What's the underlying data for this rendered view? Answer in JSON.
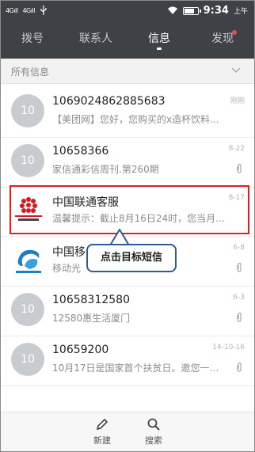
{
  "status_bar": {
    "signal_1": "4G",
    "signal_2": "4G",
    "time": "9:34",
    "ampm": "上午",
    "battery_level": 0.85
  },
  "tabs": [
    {
      "label": "拨号",
      "active": false
    },
    {
      "label": "联系人",
      "active": false
    },
    {
      "label": "信息",
      "active": true
    },
    {
      "label": "发现",
      "active": false,
      "badge": true
    }
  ],
  "section": {
    "label": "所有信息"
  },
  "messages": [
    {
      "avatar": "10",
      "name": "1069024862885683",
      "preview": "【美团网】您好，您购买的x造杯饮料...",
      "date": "刚刚",
      "attachment": false
    },
    {
      "avatar": "10",
      "name": "10658366",
      "preview": "家信通彩信周刊.第260期",
      "date": "8-22",
      "attachment": true
    },
    {
      "avatar": "China Unicom logo",
      "name": "中国联通客服",
      "preview": "温馨提示：截止8月16日24时，您当月...",
      "date": "8-17",
      "attachment": false
    },
    {
      "avatar": "China Mobile logo",
      "name": "中国移",
      "preview": "移动光",
      "date": "6-8",
      "attachment": true
    },
    {
      "avatar": "10",
      "name": "10658312580",
      "preview": "12580惠生活厦门",
      "date": "6-3",
      "attachment": true
    },
    {
      "avatar": "10",
      "name": "10659200",
      "preview": "10月17日是国家首个扶贫日。邀您一起...",
      "date": "14-10-16",
      "attachment": true
    }
  ],
  "callout": {
    "text": "点击目标短信"
  },
  "bottom_bar": {
    "new_label": "新建",
    "search_label": "搜索"
  },
  "colors": {
    "header_bg": "#3e4145",
    "highlight": "#e0201d",
    "callout_border": "#2f5d93",
    "badge": "#f04b4b"
  }
}
